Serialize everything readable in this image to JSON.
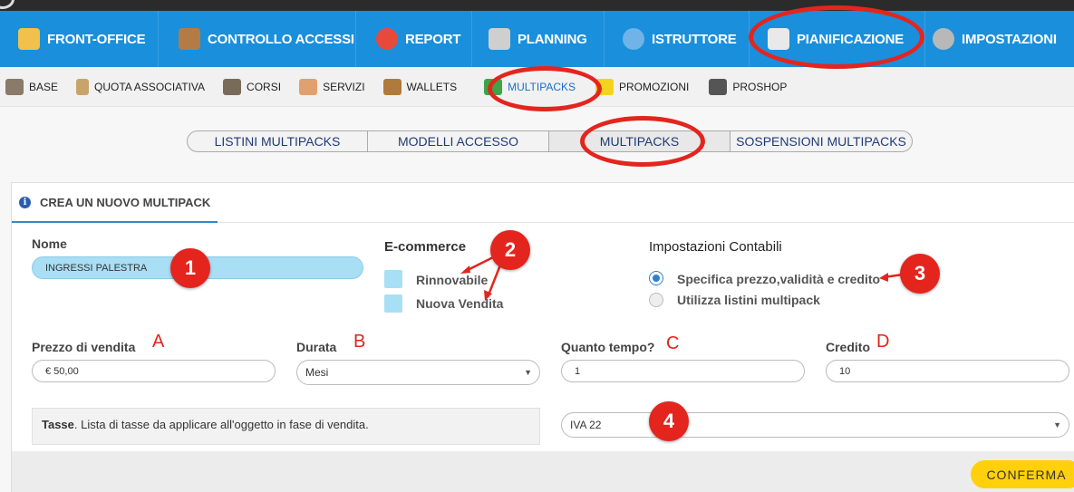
{
  "main_nav": [
    {
      "label": "FRONT-OFFICE",
      "icon": "user-icon",
      "color": "#f1c14b"
    },
    {
      "label": "CONTROLLO ACCESSI",
      "icon": "door-icon",
      "color": "#b57b45"
    },
    {
      "label": "REPORT",
      "icon": "pie-chart-icon",
      "color": "#e84a3a"
    },
    {
      "label": "PLANNING",
      "icon": "calendar-grid-icon",
      "color": "#cfcfcf"
    },
    {
      "label": "ISTRUTTORE",
      "icon": "trainers-icon",
      "color": "#6fb3e8"
    },
    {
      "label": "PIANIFICAZIONE",
      "icon": "calendar-15-icon",
      "color": "#e9e9e9"
    },
    {
      "label": "IMPOSTAZIONI",
      "icon": "gear-icon",
      "color": "#b8b8b8"
    }
  ],
  "sub_nav": [
    {
      "label": "BASE",
      "icon": "boxes-icon",
      "color": "#8a7a6a"
    },
    {
      "label": "QUOTA ASSOCIATIVA",
      "icon": "clipboard-icon",
      "color": "#c9a46a"
    },
    {
      "label": "CORSI",
      "icon": "shoes-icon",
      "color": "#7a6a5a"
    },
    {
      "label": "SERVIZI",
      "icon": "handshake-icon",
      "color": "#e0a070"
    },
    {
      "label": "WALLETS",
      "icon": "wallet-icon",
      "color": "#b07a3a"
    },
    {
      "label": "MULTIPACKS",
      "icon": "multipack-icon",
      "color": "#3da44a"
    },
    {
      "label": "PROMOZIONI",
      "icon": "star-icon",
      "color": "#f5d21c"
    },
    {
      "label": "PROSHOP",
      "icon": "cash-register-icon",
      "color": "#555555"
    }
  ],
  "tabs": [
    "LISTINI MULTIPACKS",
    "MODELLI ACCESSO",
    "MULTIPACKS",
    "SOSPENSIONI MULTIPACKS"
  ],
  "panel": {
    "title": "CREA UN NUOVO MULTIPACK",
    "nome_label": "Nome",
    "nome_value": "INGRESSI PALESTRA",
    "ecommerce_label": "E-commerce",
    "ecommerce_options": [
      "Rinnovabile",
      "Nuova Vendita"
    ],
    "contabili_label": "Impostazioni Contabili",
    "contabili_options": [
      "Specifica prezzo,validità e credito",
      "Utilizza listini multipack"
    ],
    "prezzo_label": "Prezzo di vendita",
    "prezzo_value": "€ 50,00",
    "durata_label": "Durata",
    "durata_value": "Mesi",
    "quanto_label": "Quanto tempo?",
    "quanto_value": "1",
    "credito_label": "Credito",
    "credito_value": "10",
    "tasse_bold": "Tasse",
    "tasse_text": ". Lista di tasse da applicare all'oggetto in fase di vendita.",
    "tasse_value": "IVA 22",
    "confirm_label": "CONFERMA"
  },
  "annotations": {
    "badges": [
      "1",
      "2",
      "3",
      "4"
    ],
    "letters": [
      "A",
      "B",
      "C",
      "D"
    ],
    "annotation_color": "#e3251e"
  }
}
